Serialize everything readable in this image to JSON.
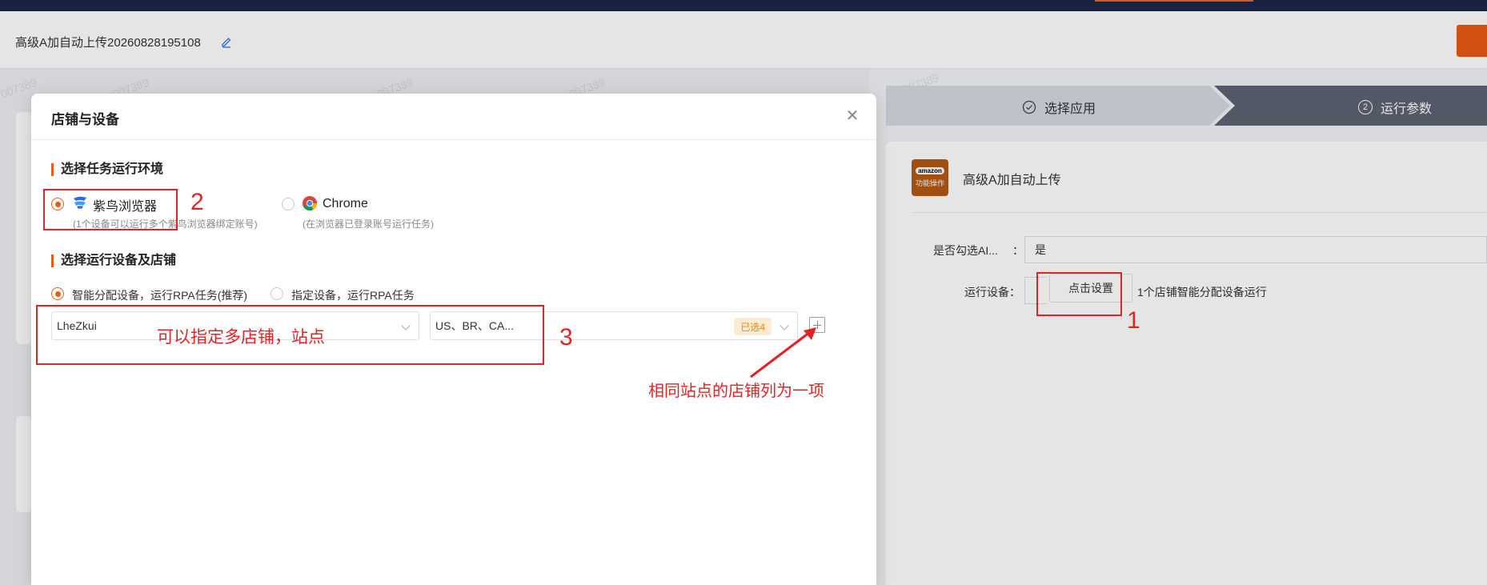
{
  "header": {
    "title": "高级A加自动上传20260828195108"
  },
  "steps": {
    "step1_label": "选择应用",
    "step2_number": "2",
    "step2_label": "运行参数"
  },
  "app": {
    "logo_top": "amazon",
    "logo_bottom": "功能操作",
    "name": "高级A加自动上传",
    "form": {
      "ai_label": "是否勾选AI...",
      "colon": "：",
      "ai_value": "是",
      "device_label": "运行设备：",
      "setup_button": "点击设置",
      "run_info": "1个店铺智能分配设备运行"
    }
  },
  "modal": {
    "title": "店铺与设备",
    "section_env": "选择任务运行环境",
    "env_options": [
      {
        "label": "紫鸟浏览器",
        "sub": "(1个设备可以运行多个紫鸟浏览器绑定账号)",
        "checked": true
      },
      {
        "label": "Chrome",
        "sub": "(在浏览器已登录账号运行任务)",
        "checked": false
      }
    ],
    "section_device": "选择运行设备及店铺",
    "device_options": [
      {
        "label": "智能分配设备，运行RPA任务(推荐)",
        "checked": true
      },
      {
        "label": "指定设备，运行RPA任务",
        "checked": false
      }
    ],
    "shop_select": "LheZkui",
    "site_select": "US、BR、CA...",
    "site_badge": "已选4"
  },
  "annotations": {
    "label1": "1",
    "label2": "2",
    "label3": "3",
    "text_multi": "可以指定多店铺，站点",
    "text_same_site": "相同站点的店铺列为一项"
  },
  "colors": {
    "accent": "#ea5a14",
    "annotation_red": "#e02424",
    "badge_bg": "#fdebd3",
    "badge_text": "#e7860e",
    "topbar": "#1d2744"
  },
  "watermark": "007389"
}
